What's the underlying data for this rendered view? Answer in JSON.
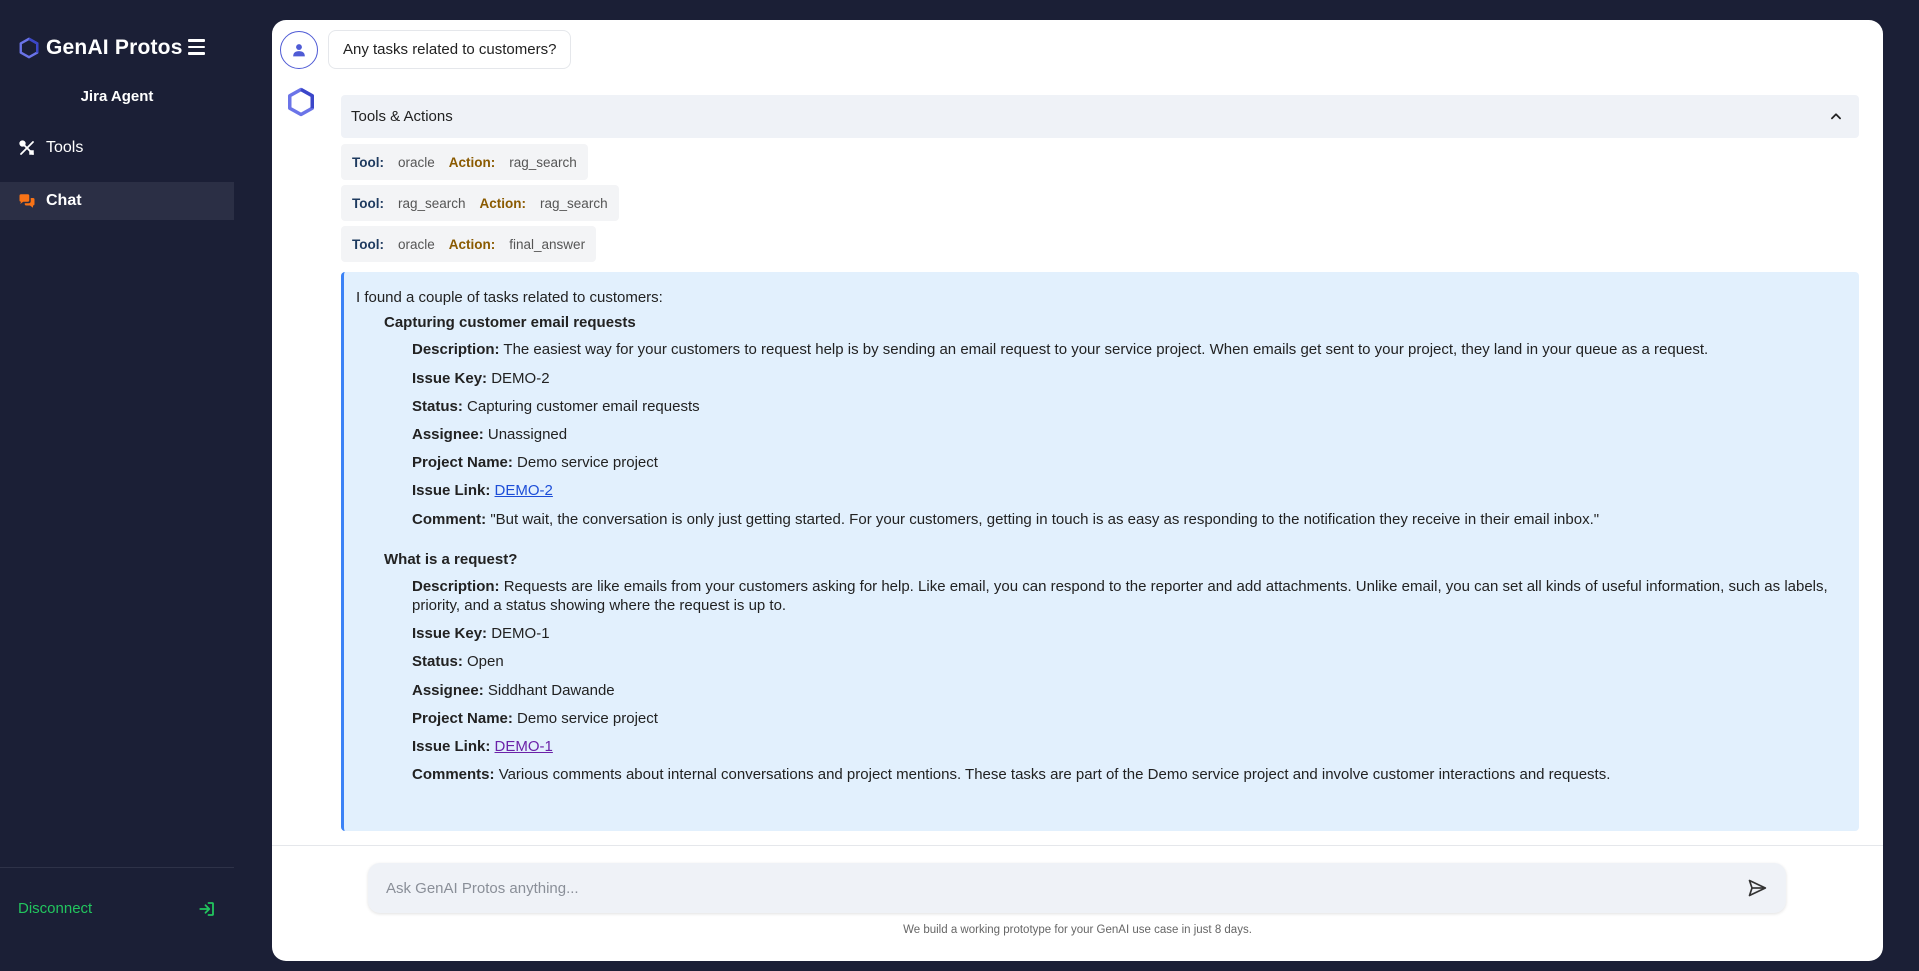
{
  "brand": {
    "name": "GenAI Protos"
  },
  "sidebar": {
    "agent_name": "Jira Agent",
    "items": [
      {
        "label": "Tools",
        "icon": "tools-icon",
        "active": false
      },
      {
        "label": "Chat",
        "icon": "chat-icon",
        "active": true
      }
    ],
    "disconnect_label": "Disconnect"
  },
  "colors": {
    "sidebar_bg": "#1b1f36",
    "accent": "#4f5bd5",
    "disconnect": "#22c55e",
    "chat_icon": "#f97316",
    "answer_bg": "#e2f0fd",
    "answer_border": "#3b82f6"
  },
  "conversation": {
    "user_message": "Any tasks related to customers?",
    "tools_header": "Tools & Actions",
    "tool_calls": [
      {
        "tool_label": "Tool:",
        "tool": "oracle",
        "action_label": "Action:",
        "action": "rag_search"
      },
      {
        "tool_label": "Tool:",
        "tool": "rag_search",
        "action_label": "Action:",
        "action": "rag_search"
      },
      {
        "tool_label": "Tool:",
        "tool": "oracle",
        "action_label": "Action:",
        "action": "final_answer"
      }
    ],
    "answer": {
      "intro": "I found a couple of tasks related to customers:",
      "tasks": [
        {
          "title": "Capturing customer email requests",
          "description_label": "Description:",
          "description": "The easiest way for your customers to request help is by sending an email request to your service project. When emails get sent to your project, they land in your queue as a request.",
          "issue_key_label": "Issue Key:",
          "issue_key": "DEMO-2",
          "status_label": "Status:",
          "status": "Capturing customer email requests",
          "assignee_label": "Assignee:",
          "assignee": "Unassigned",
          "project_label": "Project Name:",
          "project": "Demo service project",
          "link_label": "Issue Link:",
          "link_text": "DEMO-2",
          "comment_label": "Comment:",
          "comment": "\"But wait, the conversation is only just getting started. For your customers, getting in touch is as easy as responding to the notification they receive in their email inbox.\""
        },
        {
          "title": "What is a request?",
          "description_label": "Description:",
          "description": "Requests are like emails from your customers asking for help. Like email, you can respond to the reporter and add attachments. Unlike email, you can set all kinds of useful information, such as labels, priority, and a status showing where the request is up to.",
          "issue_key_label": "Issue Key:",
          "issue_key": "DEMO-1",
          "status_label": "Status:",
          "status": "Open",
          "assignee_label": "Assignee:",
          "assignee": "Siddhant Dawande",
          "project_label": "Project Name:",
          "project": "Demo service project",
          "link_label": "Issue Link:",
          "link_text": "DEMO-1",
          "comment_label": "Comments:",
          "comment": "Various comments about internal conversations and project mentions. These tasks are part of the Demo service project and involve customer interactions and requests."
        }
      ]
    }
  },
  "input": {
    "placeholder": "Ask GenAI Protos anything...",
    "value": ""
  },
  "footer": {
    "note": "We build a working prototype for your GenAI use case in just 8 days."
  }
}
